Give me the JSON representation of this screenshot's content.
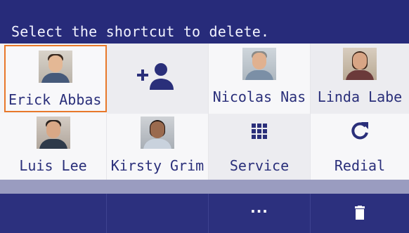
{
  "header": {
    "title": "Select the shortcut to delete."
  },
  "shortcuts": {
    "row1": [
      {
        "label": "Erick Abbas",
        "type": "contact",
        "icon": "contact-photo-erick-abbas",
        "selected": true
      },
      {
        "label": "",
        "type": "add",
        "icon": "add-contact-icon"
      },
      {
        "label": "Nicolas Nas",
        "type": "contact",
        "icon": "contact-photo-nicolas-nas"
      },
      {
        "label": "Linda Labe",
        "type": "contact",
        "icon": "contact-photo-linda-labe"
      }
    ],
    "row2": [
      {
        "label": "Luis Lee",
        "type": "contact",
        "icon": "contact-photo-luis-lee"
      },
      {
        "label": "Kirsty Grim",
        "type": "contact",
        "icon": "contact-photo-kirsty-grim"
      },
      {
        "label": "Service",
        "type": "function",
        "icon": "keypad-grid-icon"
      },
      {
        "label": "Redial",
        "type": "function",
        "icon": "redial-icon"
      }
    ]
  },
  "softkeys": [
    {
      "label": "",
      "icon": ""
    },
    {
      "label": "",
      "icon": ""
    },
    {
      "label": "···",
      "icon": "more-icon"
    },
    {
      "label": "",
      "icon": "trash-icon"
    }
  ],
  "colors": {
    "header": "#272b7a",
    "accent_text": "#2a2f7a",
    "selected_border": "#e8782a",
    "softbar": "#2c307e",
    "divider": "#9a9cc0"
  }
}
